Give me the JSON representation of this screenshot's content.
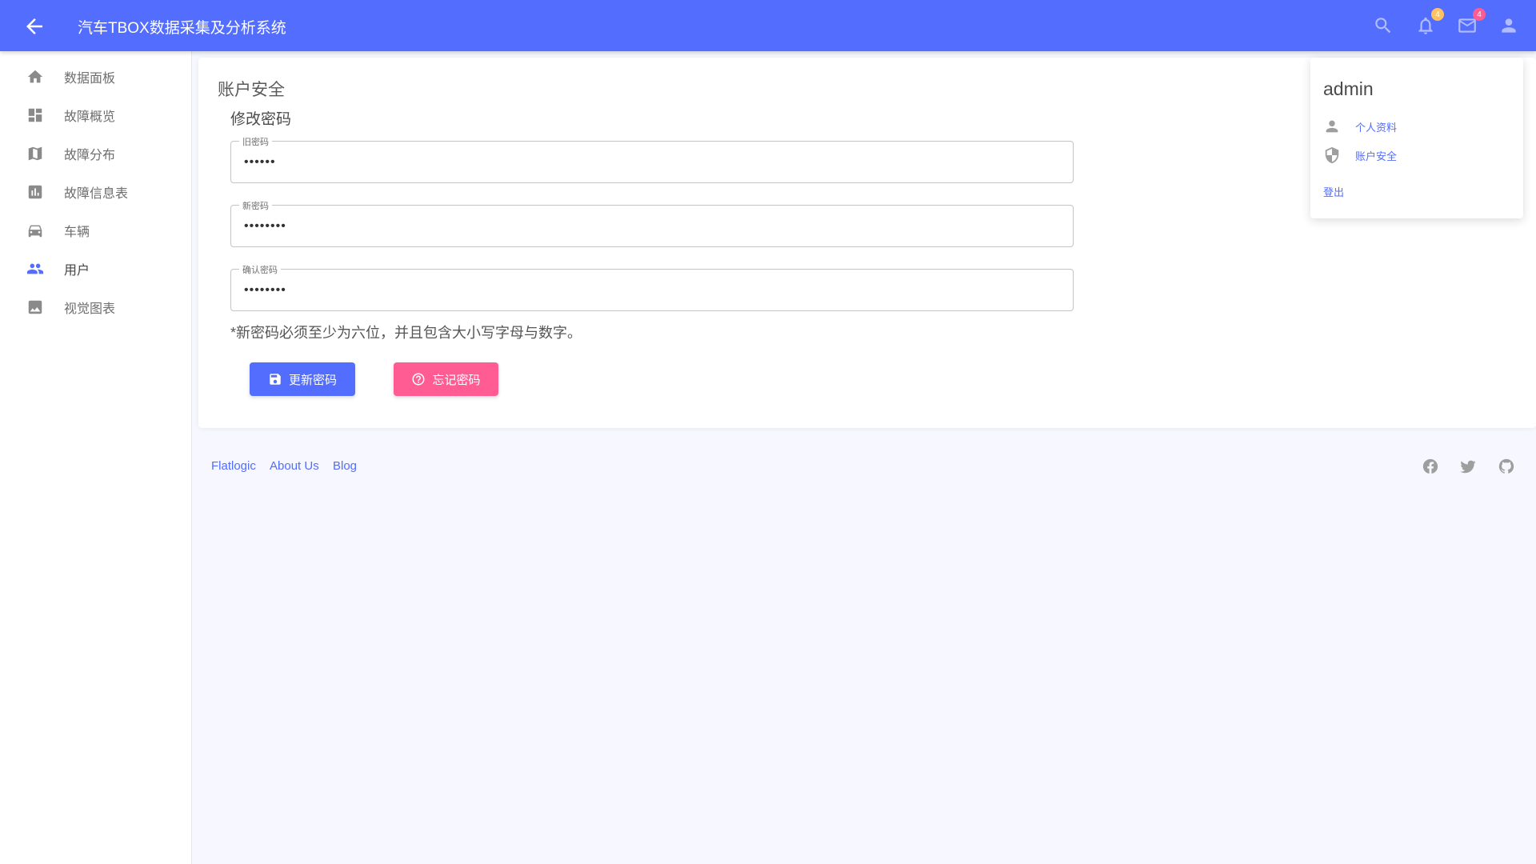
{
  "header": {
    "title": "汽车TBOX数据采集及分析系统",
    "notifications_count": "4",
    "messages_count": "4",
    "colors": {
      "bar": "#536dfe",
      "notification_badge": "#ffc260",
      "message_badge": "#ff5c93"
    }
  },
  "sidebar": {
    "items": [
      {
        "label": "数据面板",
        "icon": "home-icon"
      },
      {
        "label": "故障概览",
        "icon": "dashboard-icon"
      },
      {
        "label": "故障分布",
        "icon": "map-icon"
      },
      {
        "label": "故障信息表",
        "icon": "bar-chart-icon"
      },
      {
        "label": "车辆",
        "icon": "car-icon"
      },
      {
        "label": "用户",
        "icon": "people-icon",
        "active": true
      },
      {
        "label": "视觉图表",
        "icon": "image-icon"
      }
    ]
  },
  "main": {
    "title": "账户安全",
    "section_title": "修改密码",
    "fields": [
      {
        "label": "旧密码",
        "value": "••••••"
      },
      {
        "label": "新密码",
        "value": "••••••••"
      },
      {
        "label": "确认密码",
        "value": "••••••••"
      }
    ],
    "hint": "*新密码必须至少为六位，并且包含大小写字母与数字。",
    "update_button": "更新密码",
    "forgot_button": "忘记密码"
  },
  "footer": {
    "links": [
      "Flatlogic",
      "About Us",
      "Blog"
    ],
    "social": [
      "facebook-icon",
      "twitter-icon",
      "github-icon"
    ]
  },
  "profile_menu": {
    "name": "admin",
    "items": [
      {
        "label": "个人资料",
        "icon": "person-icon"
      },
      {
        "label": "账户安全",
        "icon": "shield-icon"
      }
    ],
    "logout": "登出"
  }
}
